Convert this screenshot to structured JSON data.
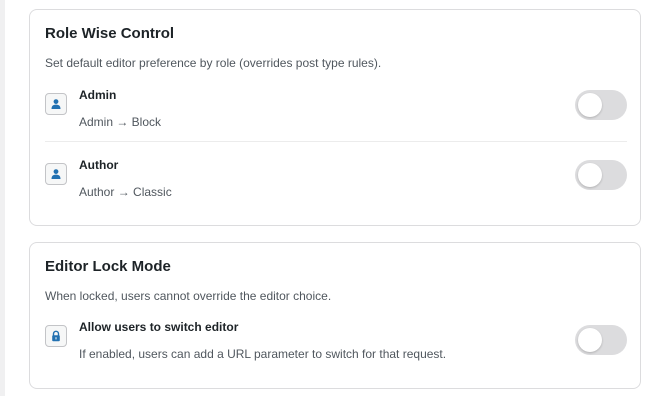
{
  "role_control": {
    "title": "Role Wise Control",
    "description": "Set default editor preference by role (overrides post type rules).",
    "roles": [
      {
        "name": "Admin",
        "rule": "Admin → Block",
        "icon": "user-icon",
        "enabled": false
      },
      {
        "name": "Author",
        "rule": "Author → Classic",
        "icon": "user-icon",
        "enabled": false
      }
    ]
  },
  "lock_mode": {
    "title": "Editor Lock Mode",
    "description": "When locked, users cannot override the editor choice.",
    "option": {
      "title": "Allow users to switch editor",
      "description": "If enabled, users can add a URL parameter to switch for that request.",
      "icon": "lock-icon",
      "enabled": false
    }
  },
  "colors": {
    "icon_accent": "#2271b1",
    "toggle_off": "#dcdcde"
  }
}
